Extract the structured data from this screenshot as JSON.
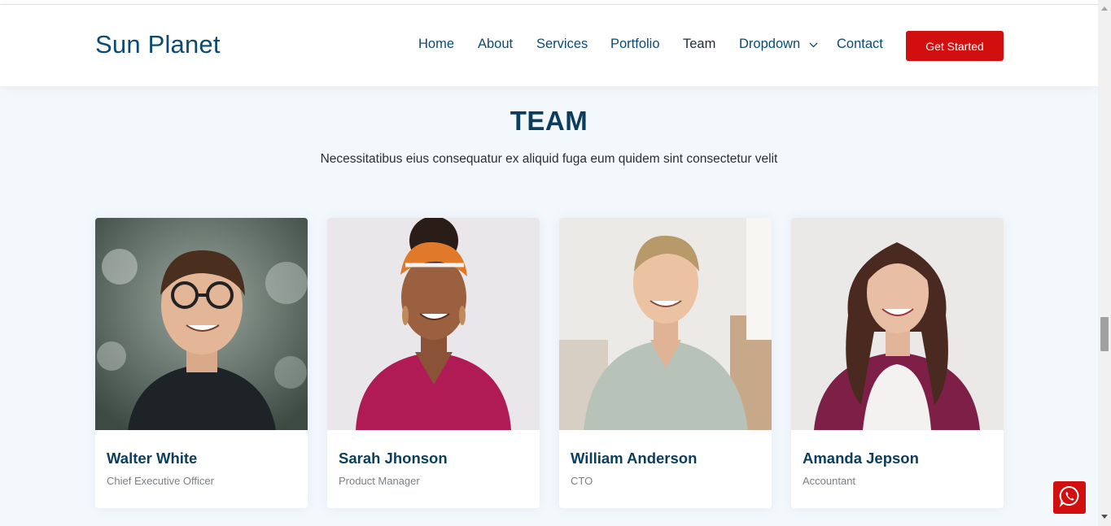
{
  "header": {
    "logo": "Sun Planet",
    "nav": [
      {
        "label": "Home",
        "active": false
      },
      {
        "label": "About",
        "active": false
      },
      {
        "label": "Services",
        "active": false
      },
      {
        "label": "Portfolio",
        "active": false
      },
      {
        "label": "Team",
        "active": true
      },
      {
        "label": "Dropdown",
        "active": false
      },
      {
        "label": "Contact",
        "active": false
      }
    ],
    "cta_label": "Get Started"
  },
  "team": {
    "title": "TEAM",
    "subtitle": "Necessitatibus eius consequatur ex aliquid fuga eum quidem sint consectetur velit",
    "members": [
      {
        "name": "Walter White",
        "role": "Chief Executive Officer"
      },
      {
        "name": "Sarah Jhonson",
        "role": "Product Manager"
      },
      {
        "name": "William Anderson",
        "role": "CTO"
      },
      {
        "name": "Amanda Jepson",
        "role": "Accountant"
      }
    ]
  },
  "icons": {
    "dropdown": "chevron-down-icon",
    "chat": "whatsapp-icon"
  },
  "colors": {
    "brand": "#0b4a73",
    "accent": "#d10f0f",
    "background": "#f2f8fc"
  }
}
